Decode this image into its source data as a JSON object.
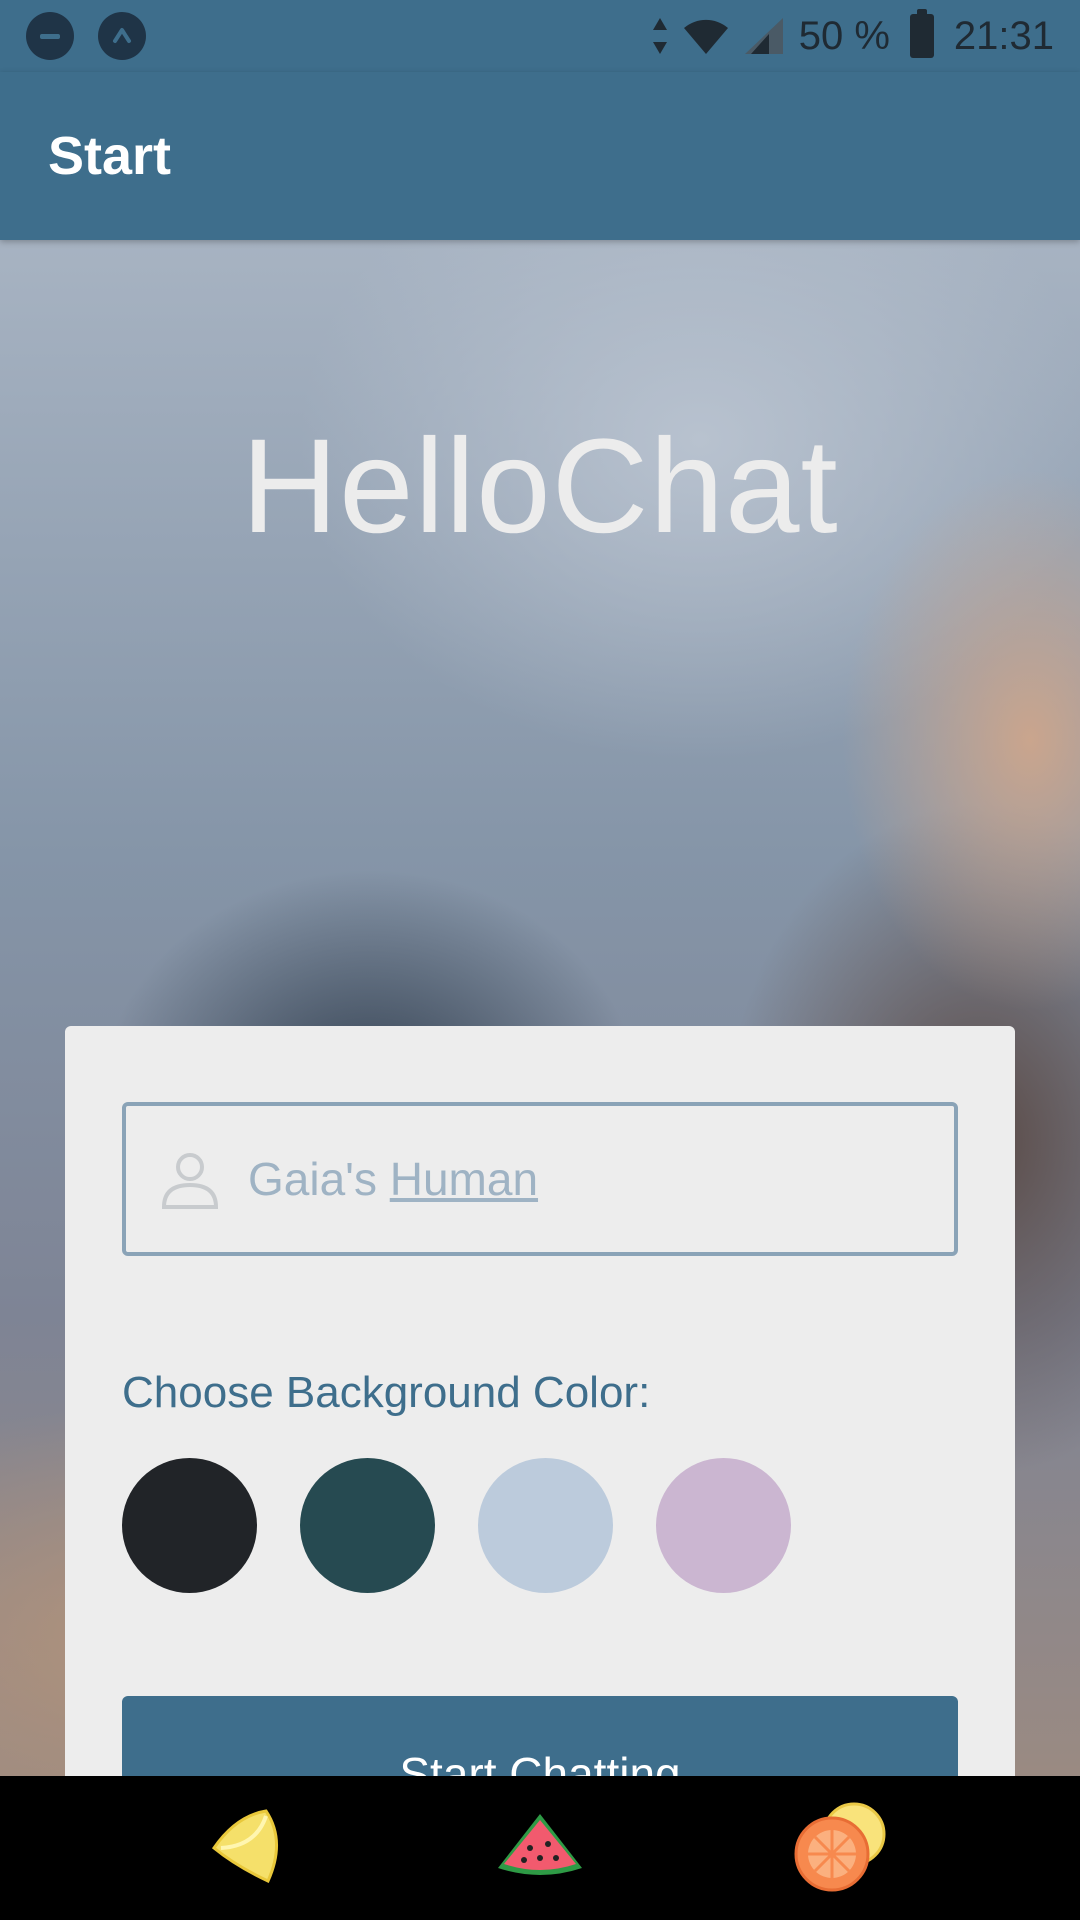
{
  "status_bar": {
    "battery": "50 %",
    "time": "21:31"
  },
  "app_bar": {
    "title": "Start"
  },
  "hero": {
    "title": "HelloChat"
  },
  "form": {
    "name_value_prefix": "Gaia's ",
    "name_value_suffix": "Human",
    "color_label": "Choose Background Color:",
    "colors": [
      "#212428",
      "#264a51",
      "#bccbdc",
      "#cbb6d1"
    ],
    "start_button_label": "Start Chatting"
  },
  "nav": {
    "items": [
      "lemon-icon",
      "watermelon-icon",
      "orange-icon"
    ]
  }
}
